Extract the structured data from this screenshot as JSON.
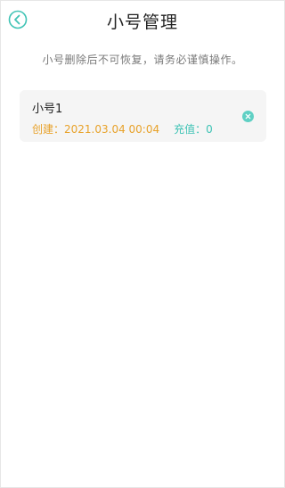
{
  "header": {
    "title": "小号管理",
    "back_icon": "chevron-left-icon"
  },
  "notice": "小号删除后不可恢复，请务必谨慎操作。",
  "accounts": [
    {
      "name": "小号1",
      "created_label": "创建：",
      "created_value": "2021.03.04 00:04",
      "recharge_label": "充值：",
      "recharge_value": "0",
      "delete_icon": "close-icon"
    }
  ],
  "colors": {
    "accent": "#3fc3b5",
    "created": "#e8a22a",
    "card_background": "#f5f5f5"
  }
}
